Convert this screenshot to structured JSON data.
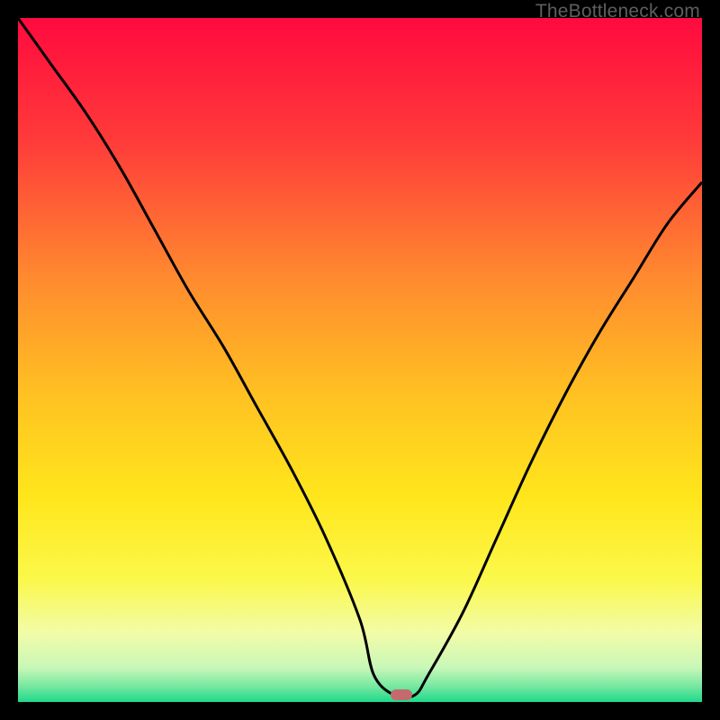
{
  "watermark": {
    "text": "TheBottleneck.com"
  },
  "chart_data": {
    "type": "line",
    "title": "",
    "xlabel": "",
    "ylabel": "",
    "xlim": [
      0,
      100
    ],
    "ylim": [
      0,
      100
    ],
    "x": [
      0,
      5,
      10,
      15,
      20,
      25,
      30,
      35,
      40,
      45,
      50,
      52,
      55,
      58,
      60,
      65,
      70,
      75,
      80,
      85,
      90,
      95,
      100
    ],
    "values": [
      100,
      93,
      86,
      78,
      69,
      60,
      52,
      43,
      34,
      24,
      12,
      4,
      1,
      1,
      4,
      13,
      24,
      35,
      45,
      54,
      62,
      70,
      76
    ],
    "optimum": {
      "x": 56,
      "y": 1
    },
    "background_gradient_stops": [
      {
        "offset": 0.0,
        "color": "#ff0a3e"
      },
      {
        "offset": 0.18,
        "color": "#ff3b3a"
      },
      {
        "offset": 0.38,
        "color": "#ff8a2f"
      },
      {
        "offset": 0.55,
        "color": "#ffc122"
      },
      {
        "offset": 0.7,
        "color": "#ffe61c"
      },
      {
        "offset": 0.82,
        "color": "#fbf84a"
      },
      {
        "offset": 0.9,
        "color": "#f2fca8"
      },
      {
        "offset": 0.95,
        "color": "#c8f7b8"
      },
      {
        "offset": 0.975,
        "color": "#7de9a3"
      },
      {
        "offset": 1.0,
        "color": "#1fd98a"
      }
    ],
    "marker_color": "#c56a6c",
    "curve_color": "#000000",
    "curve_width": 3
  }
}
